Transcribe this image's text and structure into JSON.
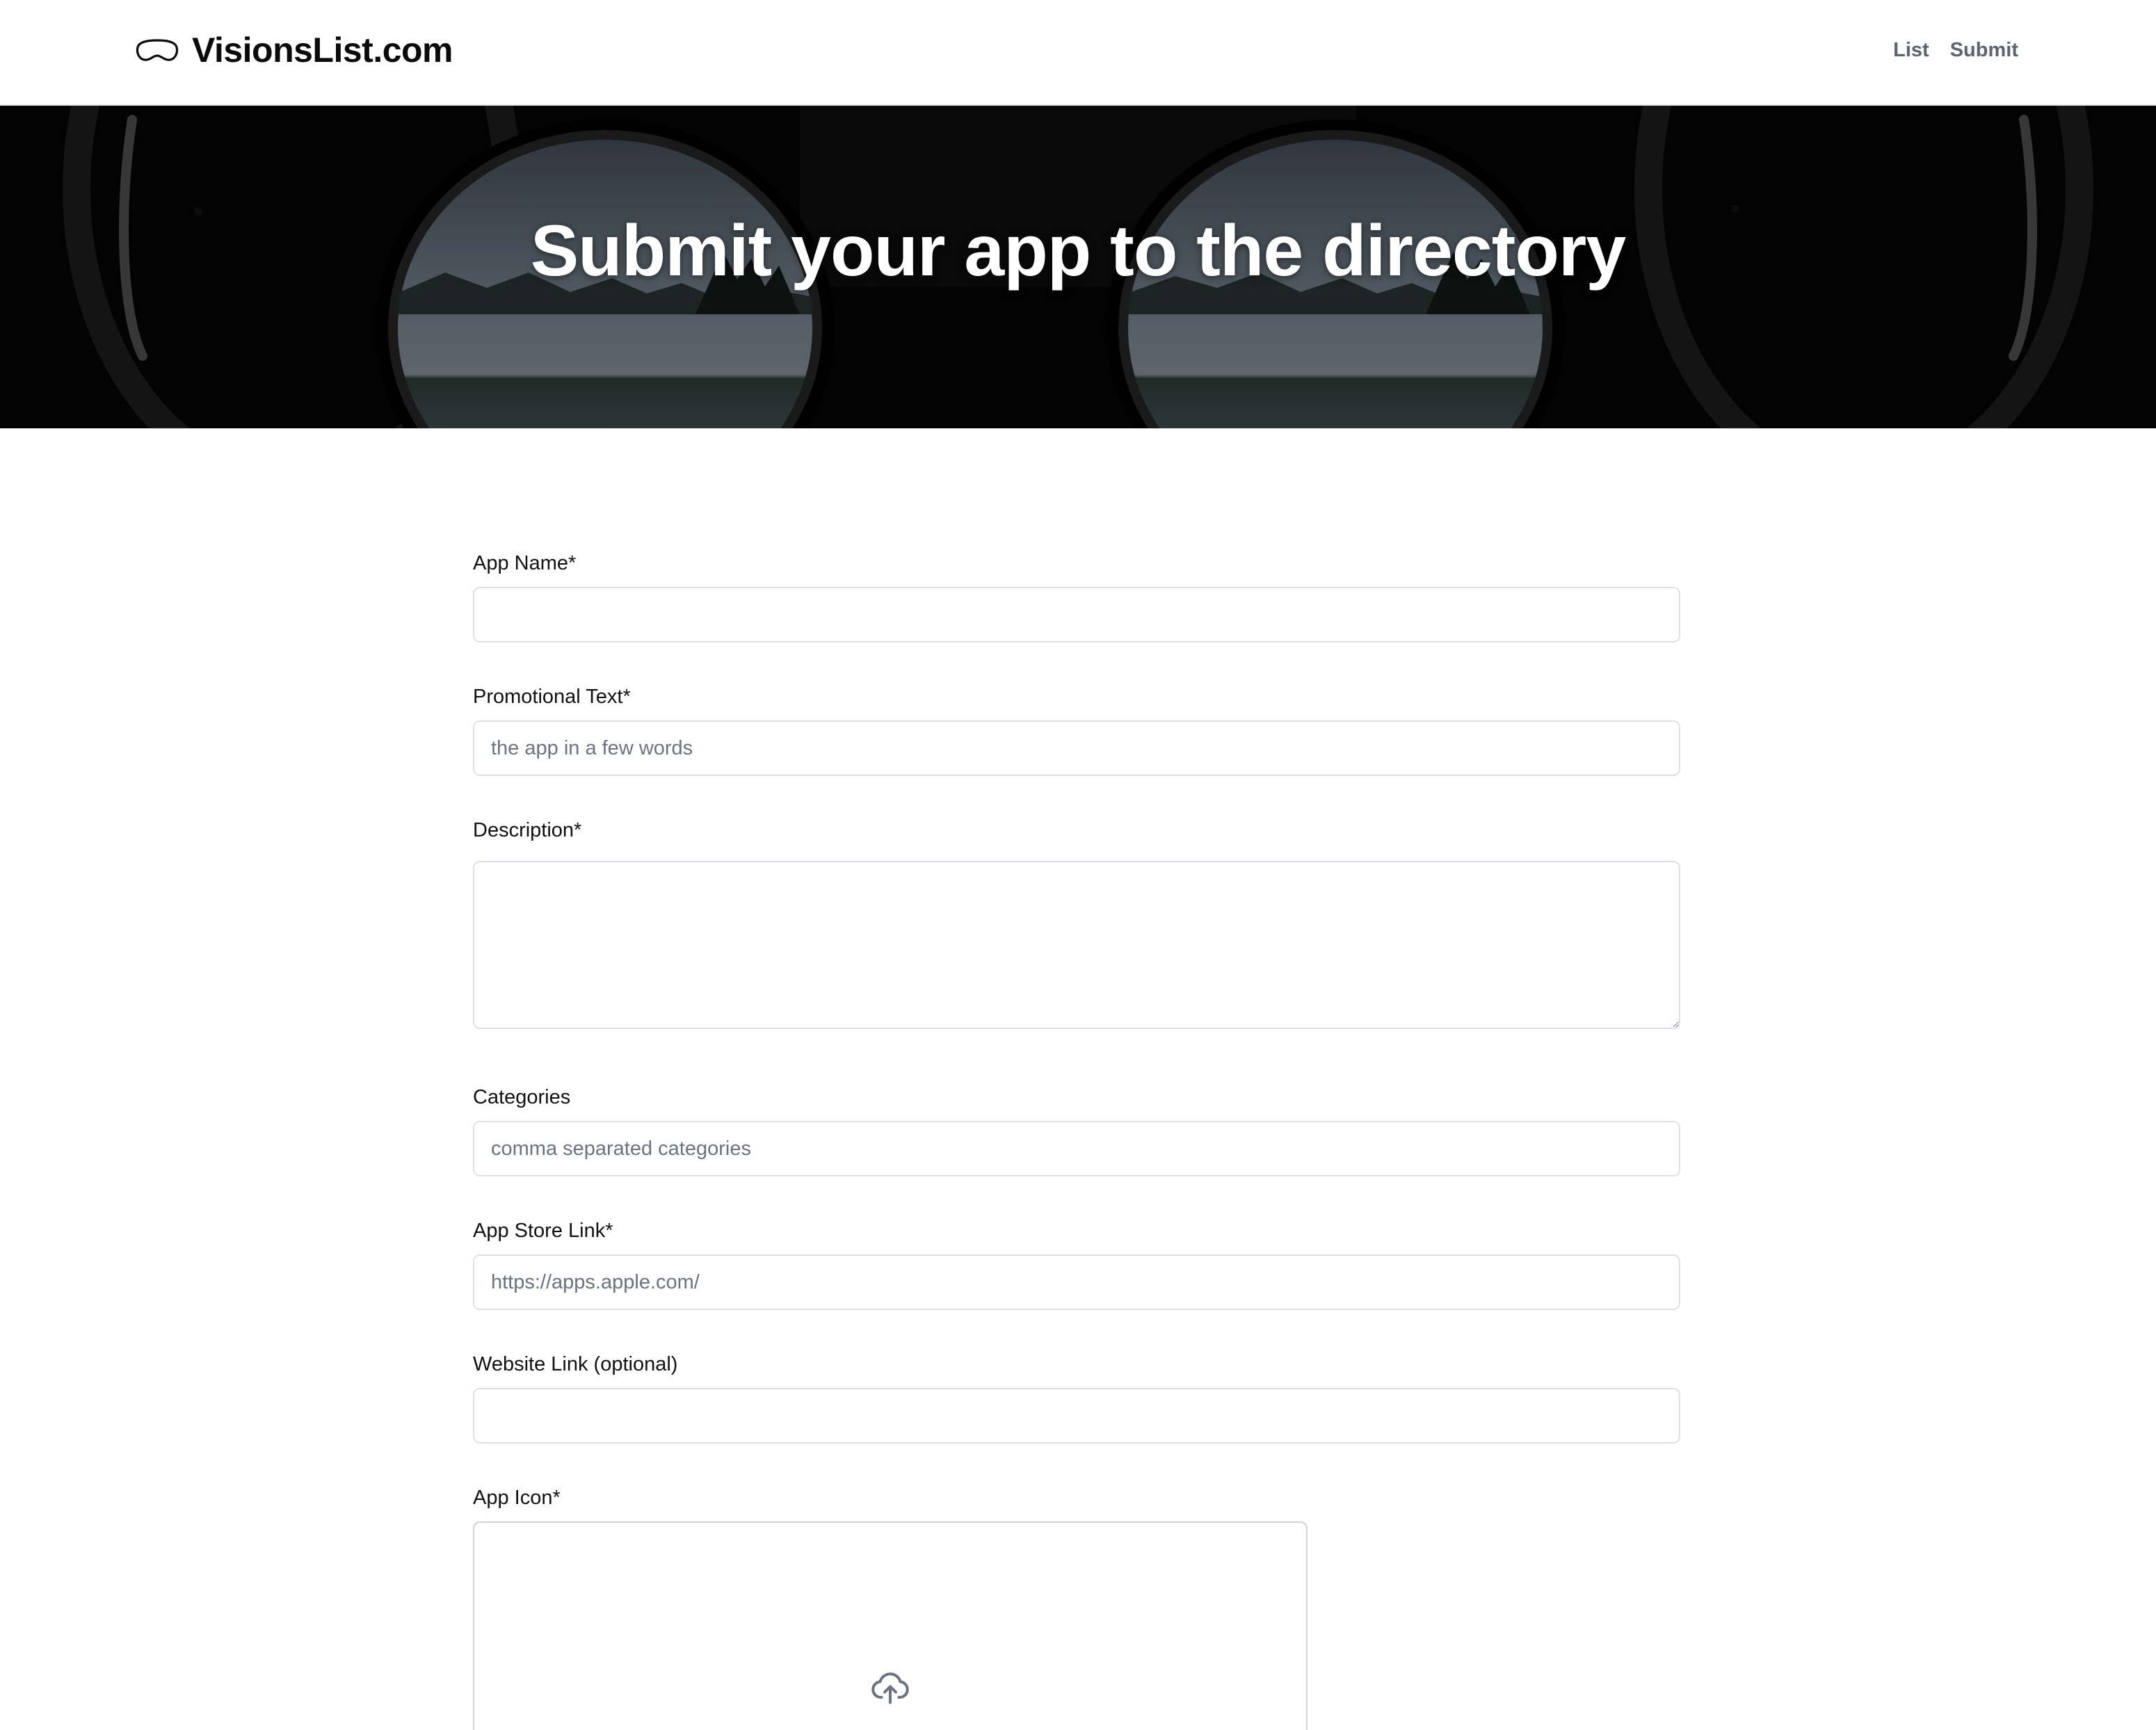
{
  "header": {
    "brand_name": "VisionsList.com",
    "brand_icon": "vision-headset-icon",
    "nav": [
      {
        "label": "List"
      },
      {
        "label": "Submit"
      }
    ]
  },
  "hero": {
    "title": "Submit your app to the directory"
  },
  "form": {
    "app_name": {
      "label": "App Name*",
      "placeholder": "",
      "value": ""
    },
    "promo_text": {
      "label": "Promotional Text*",
      "placeholder": "the app in a few words",
      "value": ""
    },
    "description": {
      "label": "Description*",
      "placeholder": "",
      "value": ""
    },
    "categories": {
      "label": "Categories",
      "placeholder": "comma separated categories",
      "value": ""
    },
    "app_store_link": {
      "label": "App Store Link*",
      "placeholder": "https://apps.apple.com/",
      "value": ""
    },
    "website_link": {
      "label": "Website Link (optional)",
      "placeholder": "",
      "value": ""
    },
    "app_icon": {
      "label": "App Icon*",
      "icon": "cloud-upload-icon"
    }
  },
  "colors": {
    "nav_text": "#5b6473",
    "border": "#dde1e7",
    "placeholder": "#6b7280",
    "hero_bg": "#050505"
  }
}
